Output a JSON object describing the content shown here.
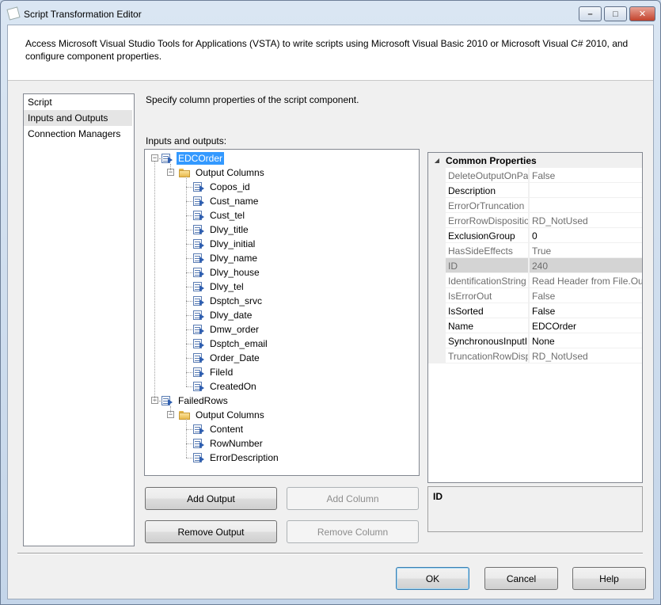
{
  "window": {
    "title": "Script Transformation Editor",
    "min_glyph": "–",
    "max_glyph": "□",
    "close_glyph": "✕"
  },
  "header": {
    "text": "Access Microsoft Visual Studio Tools for Applications (VSTA) to write scripts using Microsoft Visual Basic 2010 or Microsoft Visual C# 2010, and configure component properties."
  },
  "nav": {
    "items": [
      {
        "label": "Script",
        "selected": false
      },
      {
        "label": "Inputs and Outputs",
        "selected": true
      },
      {
        "label": "Connection Managers",
        "selected": false
      }
    ]
  },
  "main": {
    "description": "Specify column properties of the script component.",
    "io_label": "Inputs and outputs:"
  },
  "tree": {
    "outputs": [
      {
        "label": "EDCOrder",
        "selected": true,
        "folder": "Output Columns",
        "columns": [
          "Copos_id",
          "Cust_name",
          "Cust_tel",
          "Dlvy_title",
          "Dlvy_initial",
          "Dlvy_name",
          "Dlvy_house",
          "Dlvy_tel",
          "Dsptch_srvc",
          "Dlvy_date",
          "Dmw_order",
          "Dsptch_email",
          "Order_Date",
          "FileId",
          "CreatedOn"
        ]
      },
      {
        "label": "FailedRows",
        "selected": false,
        "folder": "Output Columns",
        "columns": [
          "Content",
          "RowNumber",
          "ErrorDescription"
        ]
      }
    ]
  },
  "properties": {
    "category": "Common Properties",
    "rows": [
      {
        "name": "DeleteOutputOnPa",
        "value": "False",
        "readonly": true
      },
      {
        "name": "Description",
        "value": "",
        "readonly": false
      },
      {
        "name": "ErrorOrTruncation",
        "value": "",
        "readonly": true
      },
      {
        "name": "ErrorRowDispositio",
        "value": "RD_NotUsed",
        "readonly": true
      },
      {
        "name": "ExclusionGroup",
        "value": "0",
        "readonly": false
      },
      {
        "name": "HasSideEffects",
        "value": "True",
        "readonly": true
      },
      {
        "name": "ID",
        "value": "240",
        "readonly": true,
        "highlight": true
      },
      {
        "name": "IdentificationString",
        "value": "Read Header from File.Out",
        "readonly": true
      },
      {
        "name": "IsErrorOut",
        "value": "False",
        "readonly": true
      },
      {
        "name": "IsSorted",
        "value": "False",
        "readonly": false
      },
      {
        "name": "Name",
        "value": "EDCOrder",
        "readonly": false
      },
      {
        "name": "SynchronousInputI",
        "value": "None",
        "readonly": false
      },
      {
        "name": "TruncationRowDisp",
        "value": "RD_NotUsed",
        "readonly": true
      }
    ]
  },
  "help": {
    "title": "ID"
  },
  "buttons": {
    "add_output": "Add Output",
    "add_column": "Add Column",
    "remove_output": "Remove Output",
    "remove_column": "Remove Column",
    "ok": "OK",
    "cancel": "Cancel",
    "help": "Help"
  }
}
